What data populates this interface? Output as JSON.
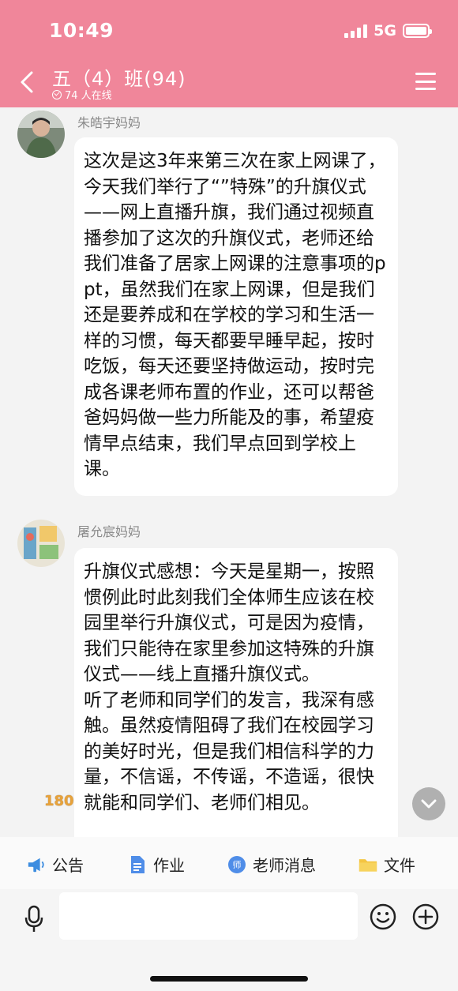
{
  "status_bar": {
    "time": "10:49",
    "network": "5G"
  },
  "header": {
    "title": "五（4）班(94)",
    "online": "74 人在线"
  },
  "messages": [
    {
      "sender": "朱皓宇妈妈",
      "text": "这次是这3年来第三次在家上网课了，今天我们举行了“”特殊”的升旗仪式——网上直播升旗，我们通过视频直播参加了这次的升旗仪式，老师还给我们准备了居家上网课的注意事项的ppt，虽然我们在家上网课，但是我们还是要养成和在学校的学习和生活一样的习惯，每天都要早睡早起，按时吃饭，每天还要坚持做运动，按时完成各课老师布置的作业，还可以帮爸爸妈妈做一些力所能及的事，希望疫情早点结束，我们早点回到学校上课。"
    },
    {
      "sender": "屠允宸妈妈",
      "text": "升旗仪式感想：今天是星期一，按照惯例此时此刻我们全体师生应该在校园里举行升旗仪式，可是因为疫情，我们只能待在家里参加这特殊的升旗仪式——线上直播升旗仪式。\n听了老师和同学们的发言，我深有感触。虽然疫情阻碍了我们在校园学习的美好时光，但是我们相信科学的力量，不信谣，不传谣，不造谣，很快就能和同学们、老师们相见。"
    }
  ],
  "overlay": {
    "counter": "180"
  },
  "toolbar": {
    "announcement": "公告",
    "homework": "作业",
    "teacher_msg": "老师消息",
    "files": "文件",
    "teacher_badge": "师"
  },
  "input": {
    "placeholder": ""
  },
  "colors": {
    "header_bg": "#f0869a",
    "chat_bg": "#f3f3f3"
  },
  "icons": [
    "back-arrow-icon",
    "menu-icon",
    "check-circle-icon",
    "megaphone-icon",
    "document-icon",
    "teacher-icon",
    "folder-icon",
    "microphone-icon",
    "emoji-icon",
    "plus-circle-icon",
    "chevron-down-icon"
  ]
}
